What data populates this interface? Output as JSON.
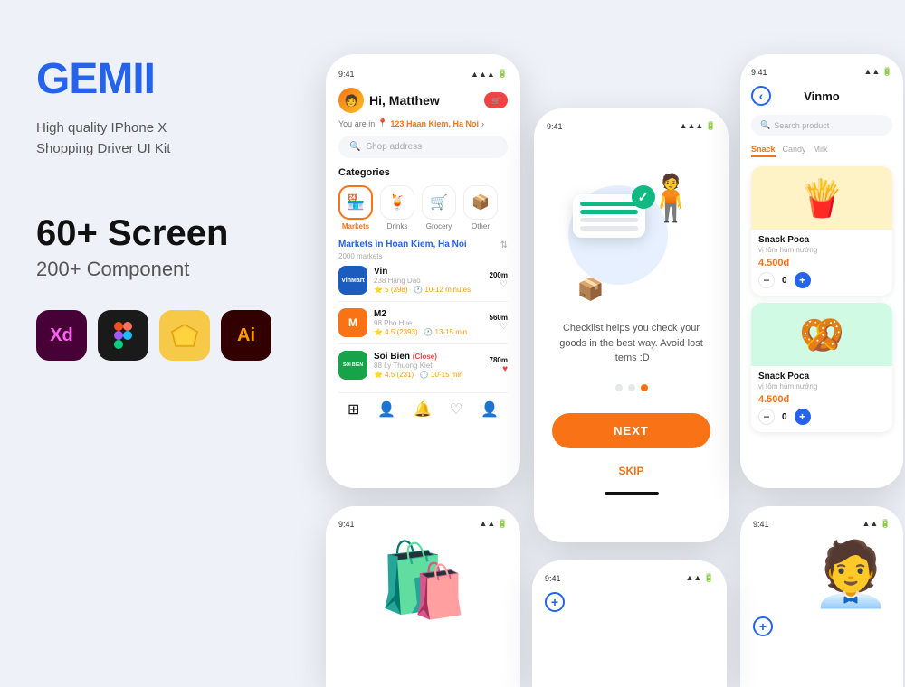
{
  "brand": {
    "logo": "GEMII",
    "tagline_line1": "High quality IPhone X",
    "tagline_line2": "Shopping Driver UI Kit"
  },
  "stats": {
    "screens": "60+ Screen",
    "components": "200+ Component"
  },
  "tools": [
    {
      "name": "Adobe XD",
      "abbr": "Xd",
      "bg": "#470137",
      "color": "#ff61f6"
    },
    {
      "name": "Figma",
      "abbr": "",
      "bg": "#1a1a1a",
      "color": "#fff"
    },
    {
      "name": "Sketch",
      "abbr": "✦",
      "bg": "#f7c948",
      "color": "#fff"
    },
    {
      "name": "Adobe Illustrator",
      "abbr": "Ai",
      "bg": "#300",
      "color": "#ff9900"
    }
  ],
  "phone1": {
    "status_time": "9:41",
    "greeting": "Hi, Matthew",
    "location_prefix": "You are in",
    "location": "123 Haan Kiem, Ha Noi",
    "search_placeholder": "Shop address",
    "categories_title": "Categories",
    "categories": [
      {
        "label": "Markets",
        "icon": "🏪",
        "active": true
      },
      {
        "label": "Drinks",
        "icon": "🍹",
        "active": false
      },
      {
        "label": "Grocery",
        "icon": "🛒",
        "active": false
      },
      {
        "label": "Other",
        "icon": "📦",
        "active": false
      }
    ],
    "markets_section": "Markets in Hoan Kiem, Ha Noi",
    "markets_count": "2000 markets",
    "markets": [
      {
        "name": "Vin",
        "brand": "VinMart",
        "address": "238 Hang Dao",
        "distance": "200m",
        "rating": "5",
        "reviews": "398",
        "time": "10-12 minutes",
        "logo_bg": "#1c5cbe",
        "logo_text": "VinMart"
      },
      {
        "name": "M2",
        "address": "98 Pho Hue",
        "distance": "560m",
        "rating": "4.5",
        "reviews": "2393",
        "time": "13-15 minutes",
        "logo_bg": "#f97316",
        "logo_text": "M"
      },
      {
        "name": "Soi Bien",
        "tag": "Close",
        "address": "88 Ly Thuong Kiet",
        "distance": "780m",
        "rating": "4.5",
        "reviews": "231",
        "time": "10-15 minutes",
        "logo_bg": "#16a34a",
        "logo_text": "SOI BIEN"
      }
    ]
  },
  "phone2": {
    "status_time": "9:41",
    "description": "Checklist helps you check your goods in the best way. Avoid lost items :D",
    "btn_next": "NEXT",
    "btn_skip": "SKIP",
    "dots": [
      false,
      false,
      true
    ]
  },
  "phone3": {
    "status_time": "9:41",
    "store_name": "Vinmo",
    "search_placeholder": "Search product",
    "filter_tabs": [
      {
        "label": "Snack",
        "active": true
      },
      {
        "label": "Candy",
        "active": false
      },
      {
        "label": "Milk",
        "active": false
      }
    ],
    "products": [
      {
        "name": "Snack Poca",
        "sub": "vị tôm hùm nướng",
        "price": "4.500đ",
        "qty": 0,
        "icon": "🍟"
      },
      {
        "name": "Snack Poca",
        "sub": "vị tôm hùm nướng",
        "price": "4.500đ",
        "qty": 0,
        "icon": "🥨"
      }
    ]
  },
  "phone4": {
    "status_time": "9:41"
  },
  "phone5": {
    "status_time": "9:41"
  },
  "phone6": {
    "status_time": "9:41"
  }
}
